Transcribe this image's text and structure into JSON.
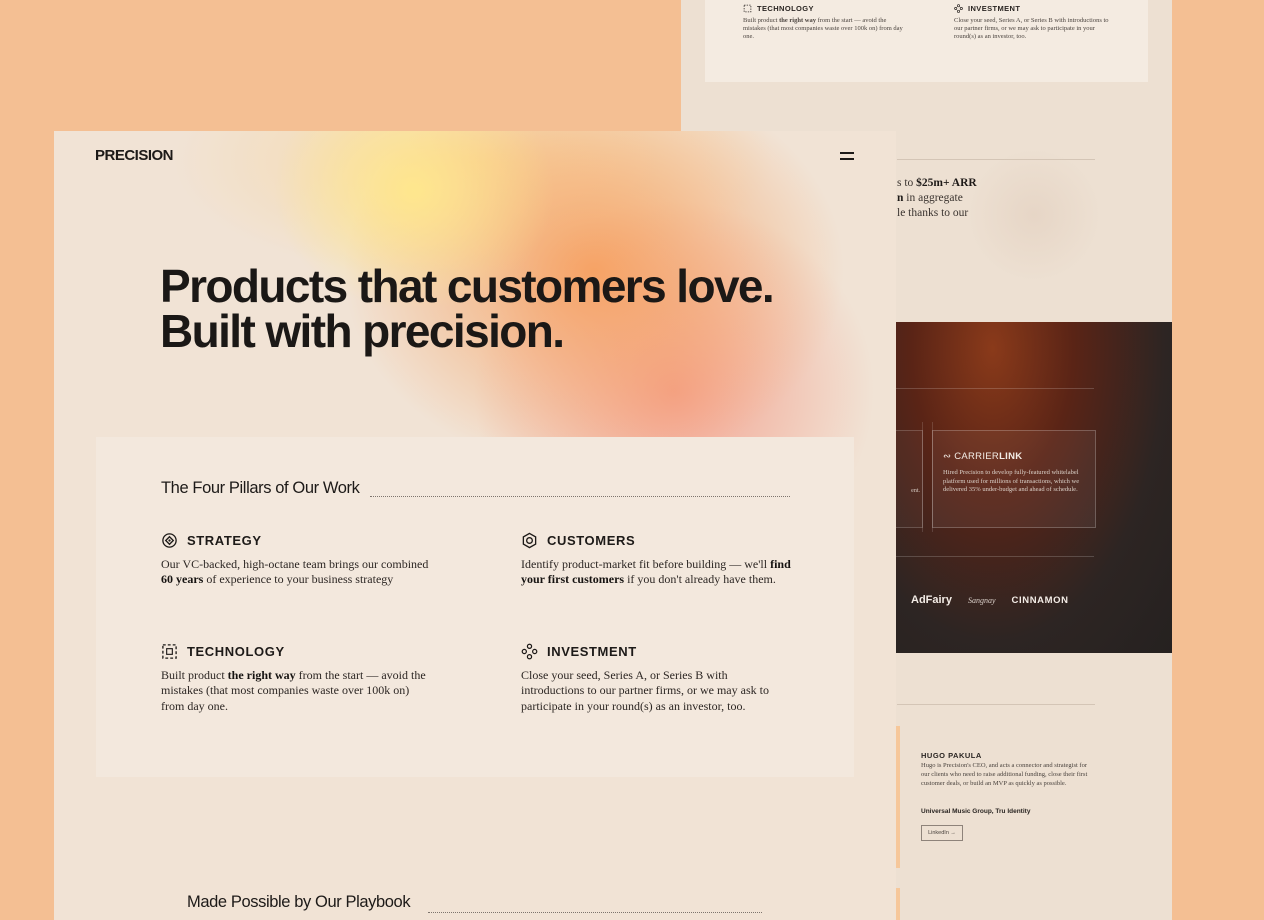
{
  "brand": "PRECISION",
  "hero": {
    "line1": "Products that customers love.",
    "line2": "Built with precision."
  },
  "pillars_section": {
    "title": "The Four Pillars of Our Work",
    "items": [
      {
        "icon": "target-icon",
        "title": "STRATEGY",
        "text_before": "Our VC-backed, high-octane team brings our combined ",
        "bold": "60 years",
        "text_after": " of experience to your business strategy"
      },
      {
        "icon": "hexagon-icon",
        "title": "CUSTOMERS",
        "text_before": "Identify product-market fit before building — we'll ",
        "bold": "find your first customers",
        "text_after": " if you don't already have them."
      },
      {
        "icon": "dashed-square-icon",
        "title": "TECHNOLOGY",
        "text_before": "Built product ",
        "bold": "the right way",
        "text_after": " from the start — avoid the mistakes (that most companies waste over 100k on) from day one."
      },
      {
        "icon": "nodes-icon",
        "title": "INVESTMENT",
        "text_before": "Close your seed, Series A, or Series B with introductions to our partner firms, or we may ask to participate in your round(s) as an investor, too.",
        "bold": "",
        "text_after": ""
      }
    ]
  },
  "playbook_section": {
    "title": "Made Possible by Our Playbook"
  },
  "background_page": {
    "mini_pillars": [
      {
        "title": "TECHNOLOGY",
        "text_before": "Built product ",
        "bold": "the right way",
        "text_after": " from the start — avoid the mistakes (that most companies waste over 100k on) from day one."
      },
      {
        "title": "INVESTMENT",
        "text_before": "Close your seed, Series A, or Series B with introductions to our partner firms, or we may ask to participate in your round(s) as an investor, too.",
        "bold": "",
        "text_after": ""
      }
    ],
    "arr_lines": {
      "line1_before": "s to ",
      "line1_bold": "$25m+ ARR",
      "line2_bold": "n",
      "line2_after": " in aggregate",
      "line3": "le thanks to our"
    },
    "case_study": {
      "name_prefix": "CARRIER",
      "name_bold": "LINK",
      "text": "Hired Precision to develop fully-featured whitelabel platform used for millions of transactions, which we delivered 35% under-budget and ahead of schedule.",
      "left_fragment": "ent."
    },
    "logos": [
      "AdFairy",
      "Sangnay",
      "CINNAMON"
    ],
    "person": {
      "name": "HUGO PAKULA",
      "bio": "Hugo is Precision's CEO, and acts a connector and strategist for our clients who need to raise additional funding, close their first customer deals, or build an MVP as quickly as possible.",
      "clients": "Universal Music Group, Tru Identity",
      "link_label": "LinkedIn →"
    }
  }
}
